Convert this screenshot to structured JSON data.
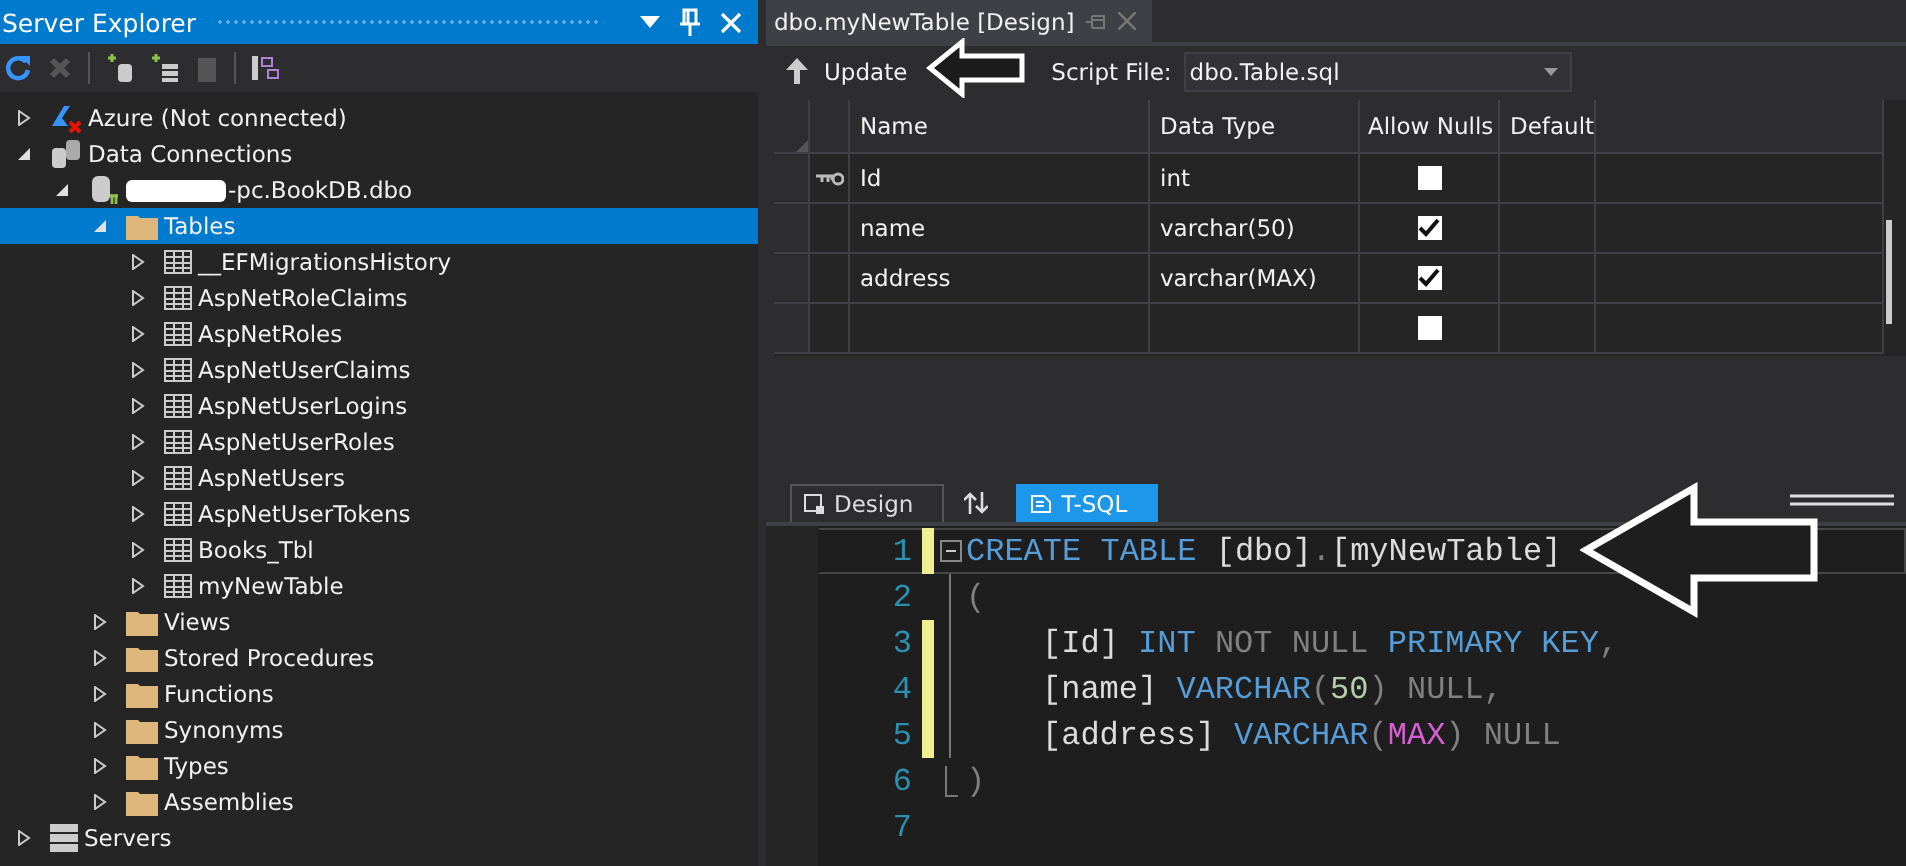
{
  "explorer": {
    "title": "Server Explorer",
    "tree": [
      {
        "label": "Azure (Not connected)",
        "kind": "cloud",
        "expanded": false,
        "selected": false
      },
      {
        "label": "Data Connections",
        "kind": "connections",
        "expanded": true,
        "selected": false,
        "children": [
          {
            "label": "-pc.BookDB.dbo",
            "kind": "database",
            "redacted": true,
            "expanded": true,
            "selected": false,
            "children": [
              {
                "label": "Tables",
                "kind": "folder",
                "expanded": true,
                "selected": true,
                "children": [
                  {
                    "label": "__EFMigrationsHistory",
                    "kind": "table",
                    "expanded": false,
                    "selected": false
                  },
                  {
                    "label": "AspNetRoleClaims",
                    "kind": "table",
                    "expanded": false,
                    "selected": false
                  },
                  {
                    "label": "AspNetRoles",
                    "kind": "table",
                    "expanded": false,
                    "selected": false
                  },
                  {
                    "label": "AspNetUserClaims",
                    "kind": "table",
                    "expanded": false,
                    "selected": false
                  },
                  {
                    "label": "AspNetUserLogins",
                    "kind": "table",
                    "expanded": false,
                    "selected": false
                  },
                  {
                    "label": "AspNetUserRoles",
                    "kind": "table",
                    "expanded": false,
                    "selected": false
                  },
                  {
                    "label": "AspNetUsers",
                    "kind": "table",
                    "expanded": false,
                    "selected": false
                  },
                  {
                    "label": "AspNetUserTokens",
                    "kind": "table",
                    "expanded": false,
                    "selected": false
                  },
                  {
                    "label": "Books_Tbl",
                    "kind": "table",
                    "expanded": false,
                    "selected": false
                  },
                  {
                    "label": "myNewTable",
                    "kind": "table",
                    "expanded": false,
                    "selected": false
                  }
                ]
              },
              {
                "label": "Views",
                "kind": "folder",
                "expanded": false,
                "selected": false
              },
              {
                "label": "Stored Procedures",
                "kind": "folder",
                "expanded": false,
                "selected": false
              },
              {
                "label": "Functions",
                "kind": "folder",
                "expanded": false,
                "selected": false
              },
              {
                "label": "Synonyms",
                "kind": "folder",
                "expanded": false,
                "selected": false
              },
              {
                "label": "Types",
                "kind": "folder",
                "expanded": false,
                "selected": false
              },
              {
                "label": "Assemblies",
                "kind": "folder",
                "expanded": false,
                "selected": false
              }
            ]
          }
        ]
      },
      {
        "label": "Servers",
        "kind": "servers",
        "expanded": false,
        "selected": false
      }
    ]
  },
  "editor": {
    "tab": "dbo.myNewTable [Design]",
    "toolbar": {
      "update": "Update",
      "script_label": "Script File:",
      "script_file": "dbo.Table.sql"
    },
    "table": {
      "columns": [
        "Name",
        "Data Type",
        "Allow Nulls",
        "Default"
      ],
      "rows": [
        {
          "name": "Id",
          "data_type": "int",
          "allow_nulls": false,
          "primary_key": true
        },
        {
          "name": "name",
          "data_type": "varchar(50)",
          "allow_nulls": true,
          "primary_key": false
        },
        {
          "name": "address",
          "data_type": "varchar(MAX)",
          "allow_nulls": true,
          "primary_key": false
        },
        {
          "allow_nulls": false,
          "primary_key": false
        }
      ]
    },
    "view_tabs": [
      {
        "label": "Design",
        "selected": false
      },
      {
        "label": "T-SQL",
        "selected": true
      }
    ],
    "code": [
      {
        "number": "1",
        "modified": true,
        "current": true,
        "kind": "start",
        "indent": false,
        "tokens": [
          {
            "text": "CREATE",
            "kind": "keyword"
          },
          {
            "text": "TABLE",
            "kind": "keyword"
          },
          {
            "text": "[dbo]",
            "kind": "plain"
          },
          {
            "text": ".",
            "kind": "gray"
          },
          {
            "text": "[myNewTable]",
            "kind": "plain"
          }
        ]
      },
      {
        "number": "2",
        "modified": false,
        "current": false,
        "kind": "body",
        "indent": false,
        "tokens": [
          {
            "text": "(",
            "kind": "gray"
          }
        ]
      },
      {
        "number": "3",
        "modified": true,
        "current": false,
        "kind": "body",
        "indent": true,
        "tokens": [
          {
            "text": "[Id]",
            "kind": "plain"
          },
          {
            "text": "INT",
            "kind": "keyword"
          },
          {
            "text": "NOT NULL",
            "kind": "gray"
          },
          {
            "text": "PRIMARY KEY",
            "kind": "keyword"
          },
          {
            "text": ",",
            "kind": "gray"
          }
        ]
      },
      {
        "number": "4",
        "modified": true,
        "current": false,
        "kind": "body",
        "indent": true,
        "tokens": [
          {
            "text": "[name]",
            "kind": "plain"
          },
          {
            "text": "VARCHAR",
            "kind": "keyword"
          },
          {
            "text": "(",
            "kind": "gray"
          },
          {
            "text": "50",
            "kind": "number"
          },
          {
            "text": ")",
            "kind": "gray"
          },
          {
            "text": "NULL,",
            "kind": "gray"
          }
        ]
      },
      {
        "number": "5",
        "modified": true,
        "current": false,
        "kind": "body",
        "indent": true,
        "tokens": [
          {
            "text": "[address]",
            "kind": "plain"
          },
          {
            "text": "VARCHAR",
            "kind": "keyword"
          },
          {
            "text": "(",
            "kind": "gray"
          },
          {
            "text": "MAX",
            "kind": "function"
          },
          {
            "text": ")",
            "kind": "gray"
          },
          {
            "text": "NULL",
            "kind": "gray"
          }
        ]
      },
      {
        "number": "6",
        "modified": false,
        "current": false,
        "kind": "end",
        "indent": false,
        "tokens": [
          {
            "text": ")",
            "kind": "gray"
          }
        ]
      },
      {
        "number": "7",
        "modified": false,
        "current": false,
        "kind": "none"
      }
    ]
  }
}
